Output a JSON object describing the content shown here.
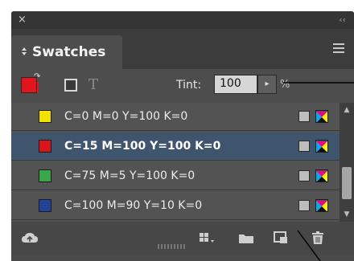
{
  "panel": {
    "close_glyph": "×",
    "collapse_glyph": "‹‹",
    "tab_label": "Swatches",
    "menu_icon": "hamburger-menu-icon"
  },
  "toolbar": {
    "fill_stroke_icon": "fill-stroke-proxy-icon",
    "fill_color": "#e3141c",
    "text_icon_glyph": "T",
    "tint_label": "Tint:",
    "tint_value": "100",
    "stepper_glyph": "▸",
    "percent": "%"
  },
  "swatches": [
    {
      "name": "C=0 M=0 Y=100 K=0",
      "color": "#f5e100",
      "selected": false
    },
    {
      "name": "C=15 M=100 Y=100 K=0",
      "color": "#d8161b",
      "selected": true
    },
    {
      "name": "C=75 M=5 Y=100 K=0",
      "color": "#3aa84a",
      "selected": false
    },
    {
      "name": "C=100 M=90 Y=10 K=0",
      "color": "#22429a",
      "selected": false
    }
  ],
  "bottom_icons": [
    "cloud-library-icon",
    "show-swatch-kinds-icon",
    "new-color-group-icon",
    "new-swatch-icon",
    "delete-swatch-icon"
  ],
  "colors": {
    "selected_row": "#3f556e",
    "panel_bg": "#4a4a4a"
  }
}
